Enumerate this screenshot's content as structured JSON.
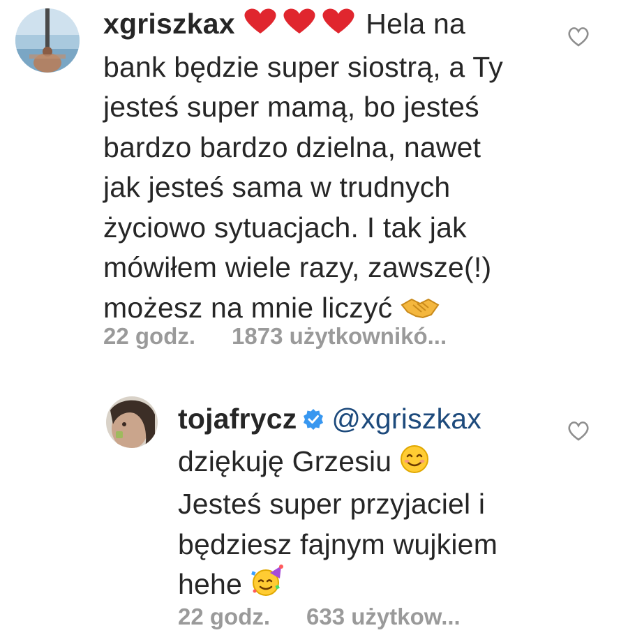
{
  "comments": [
    {
      "username": "xgriszkax",
      "hearts_emoji": "❤️❤️❤️",
      "lines": [
        "Hela na",
        "bank będzie super siostrą, a Ty",
        "jesteś super mamą, bo jesteś",
        "bardzo bardzo dzielna, nawet",
        "jak jesteś sama w trudnych",
        "życiowo sytuacjach. I tak jak",
        "mówiłem wiele razy, zawsze(!)",
        "możesz na mnie liczyć"
      ],
      "end_emoji": "handshake-icon",
      "time": "22 godz.",
      "likes": "1873 użytkownikó..."
    },
    {
      "username": "tojafrycz",
      "verified": true,
      "mention": "@xgriszkax",
      "lines": [
        "dziękuję Grzesiu",
        "Jesteś super przyjaciel i",
        "będziesz fajnym wujkiem",
        "hehe"
      ],
      "emoji_after_line1": "smiling-face-icon",
      "end_emoji": "party-face-icon",
      "time": "22 godz.",
      "likes": "633 użytkow..."
    }
  ],
  "colors": {
    "text": "#262626",
    "meta": "#9a9a9a",
    "mention": "#1d4a7c",
    "verified": "#3897f0",
    "heart_emoji": "#e0262e"
  }
}
